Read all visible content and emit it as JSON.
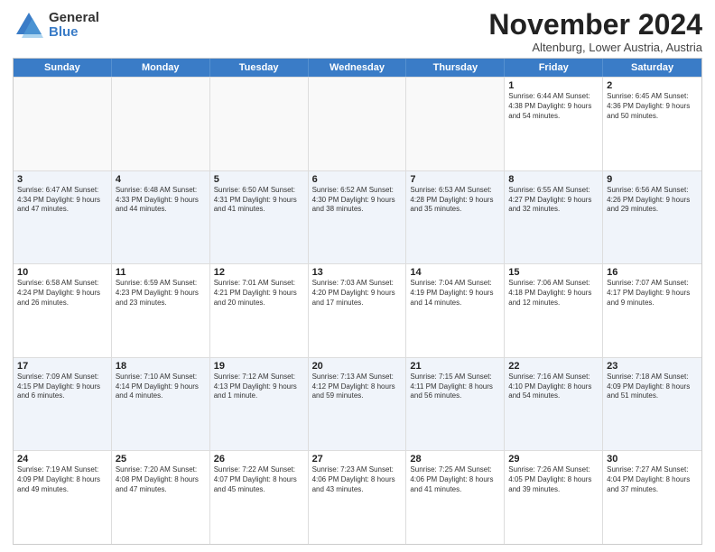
{
  "logo": {
    "general": "General",
    "blue": "Blue"
  },
  "title": "November 2024",
  "subtitle": "Altenburg, Lower Austria, Austria",
  "headers": [
    "Sunday",
    "Monday",
    "Tuesday",
    "Wednesday",
    "Thursday",
    "Friday",
    "Saturday"
  ],
  "rows": [
    [
      {
        "day": "",
        "info": "",
        "empty": true
      },
      {
        "day": "",
        "info": "",
        "empty": true
      },
      {
        "day": "",
        "info": "",
        "empty": true
      },
      {
        "day": "",
        "info": "",
        "empty": true
      },
      {
        "day": "",
        "info": "",
        "empty": true
      },
      {
        "day": "1",
        "info": "Sunrise: 6:44 AM\nSunset: 4:38 PM\nDaylight: 9 hours\nand 54 minutes.",
        "empty": false
      },
      {
        "day": "2",
        "info": "Sunrise: 6:45 AM\nSunset: 4:36 PM\nDaylight: 9 hours\nand 50 minutes.",
        "empty": false
      }
    ],
    [
      {
        "day": "3",
        "info": "Sunrise: 6:47 AM\nSunset: 4:34 PM\nDaylight: 9 hours\nand 47 minutes.",
        "empty": false
      },
      {
        "day": "4",
        "info": "Sunrise: 6:48 AM\nSunset: 4:33 PM\nDaylight: 9 hours\nand 44 minutes.",
        "empty": false
      },
      {
        "day": "5",
        "info": "Sunrise: 6:50 AM\nSunset: 4:31 PM\nDaylight: 9 hours\nand 41 minutes.",
        "empty": false
      },
      {
        "day": "6",
        "info": "Sunrise: 6:52 AM\nSunset: 4:30 PM\nDaylight: 9 hours\nand 38 minutes.",
        "empty": false
      },
      {
        "day": "7",
        "info": "Sunrise: 6:53 AM\nSunset: 4:28 PM\nDaylight: 9 hours\nand 35 minutes.",
        "empty": false
      },
      {
        "day": "8",
        "info": "Sunrise: 6:55 AM\nSunset: 4:27 PM\nDaylight: 9 hours\nand 32 minutes.",
        "empty": false
      },
      {
        "day": "9",
        "info": "Sunrise: 6:56 AM\nSunset: 4:26 PM\nDaylight: 9 hours\nand 29 minutes.",
        "empty": false
      }
    ],
    [
      {
        "day": "10",
        "info": "Sunrise: 6:58 AM\nSunset: 4:24 PM\nDaylight: 9 hours\nand 26 minutes.",
        "empty": false
      },
      {
        "day": "11",
        "info": "Sunrise: 6:59 AM\nSunset: 4:23 PM\nDaylight: 9 hours\nand 23 minutes.",
        "empty": false
      },
      {
        "day": "12",
        "info": "Sunrise: 7:01 AM\nSunset: 4:21 PM\nDaylight: 9 hours\nand 20 minutes.",
        "empty": false
      },
      {
        "day": "13",
        "info": "Sunrise: 7:03 AM\nSunset: 4:20 PM\nDaylight: 9 hours\nand 17 minutes.",
        "empty": false
      },
      {
        "day": "14",
        "info": "Sunrise: 7:04 AM\nSunset: 4:19 PM\nDaylight: 9 hours\nand 14 minutes.",
        "empty": false
      },
      {
        "day": "15",
        "info": "Sunrise: 7:06 AM\nSunset: 4:18 PM\nDaylight: 9 hours\nand 12 minutes.",
        "empty": false
      },
      {
        "day": "16",
        "info": "Sunrise: 7:07 AM\nSunset: 4:17 PM\nDaylight: 9 hours\nand 9 minutes.",
        "empty": false
      }
    ],
    [
      {
        "day": "17",
        "info": "Sunrise: 7:09 AM\nSunset: 4:15 PM\nDaylight: 9 hours\nand 6 minutes.",
        "empty": false
      },
      {
        "day": "18",
        "info": "Sunrise: 7:10 AM\nSunset: 4:14 PM\nDaylight: 9 hours\nand 4 minutes.",
        "empty": false
      },
      {
        "day": "19",
        "info": "Sunrise: 7:12 AM\nSunset: 4:13 PM\nDaylight: 9 hours\nand 1 minute.",
        "empty": false
      },
      {
        "day": "20",
        "info": "Sunrise: 7:13 AM\nSunset: 4:12 PM\nDaylight: 8 hours\nand 59 minutes.",
        "empty": false
      },
      {
        "day": "21",
        "info": "Sunrise: 7:15 AM\nSunset: 4:11 PM\nDaylight: 8 hours\nand 56 minutes.",
        "empty": false
      },
      {
        "day": "22",
        "info": "Sunrise: 7:16 AM\nSunset: 4:10 PM\nDaylight: 8 hours\nand 54 minutes.",
        "empty": false
      },
      {
        "day": "23",
        "info": "Sunrise: 7:18 AM\nSunset: 4:09 PM\nDaylight: 8 hours\nand 51 minutes.",
        "empty": false
      }
    ],
    [
      {
        "day": "24",
        "info": "Sunrise: 7:19 AM\nSunset: 4:09 PM\nDaylight: 8 hours\nand 49 minutes.",
        "empty": false
      },
      {
        "day": "25",
        "info": "Sunrise: 7:20 AM\nSunset: 4:08 PM\nDaylight: 8 hours\nand 47 minutes.",
        "empty": false
      },
      {
        "day": "26",
        "info": "Sunrise: 7:22 AM\nSunset: 4:07 PM\nDaylight: 8 hours\nand 45 minutes.",
        "empty": false
      },
      {
        "day": "27",
        "info": "Sunrise: 7:23 AM\nSunset: 4:06 PM\nDaylight: 8 hours\nand 43 minutes.",
        "empty": false
      },
      {
        "day": "28",
        "info": "Sunrise: 7:25 AM\nSunset: 4:06 PM\nDaylight: 8 hours\nand 41 minutes.",
        "empty": false
      },
      {
        "day": "29",
        "info": "Sunrise: 7:26 AM\nSunset: 4:05 PM\nDaylight: 8 hours\nand 39 minutes.",
        "empty": false
      },
      {
        "day": "30",
        "info": "Sunrise: 7:27 AM\nSunset: 4:04 PM\nDaylight: 8 hours\nand 37 minutes.",
        "empty": false
      }
    ]
  ]
}
